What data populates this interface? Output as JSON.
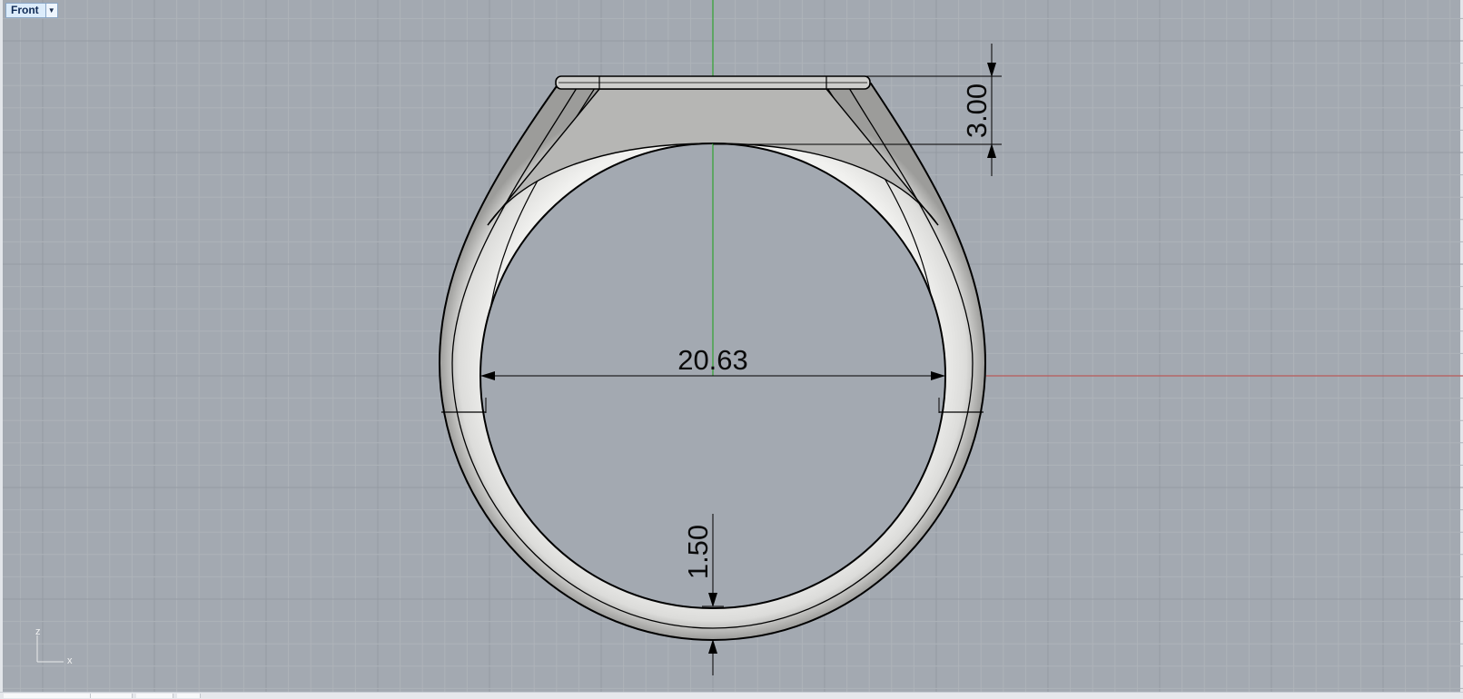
{
  "viewport": {
    "name": "Front",
    "menu_icon": "chevron-down-icon"
  },
  "dimensions": {
    "top_thickness": "3.00",
    "inner_diameter": "20.63",
    "bottom_thickness": "1.50"
  },
  "axis_widget": {
    "vertical_label": "z",
    "horizontal_label": "x"
  },
  "colors": {
    "background": "#a3a9b1",
    "grid_minor": "#aeb3b9",
    "grid_major": "#959ba3",
    "world_axis_x": "#b85a5a",
    "world_axis_z": "#3aa33a",
    "ring_fill": "#e2e2e0",
    "ring_top": "#b5b5b3"
  }
}
